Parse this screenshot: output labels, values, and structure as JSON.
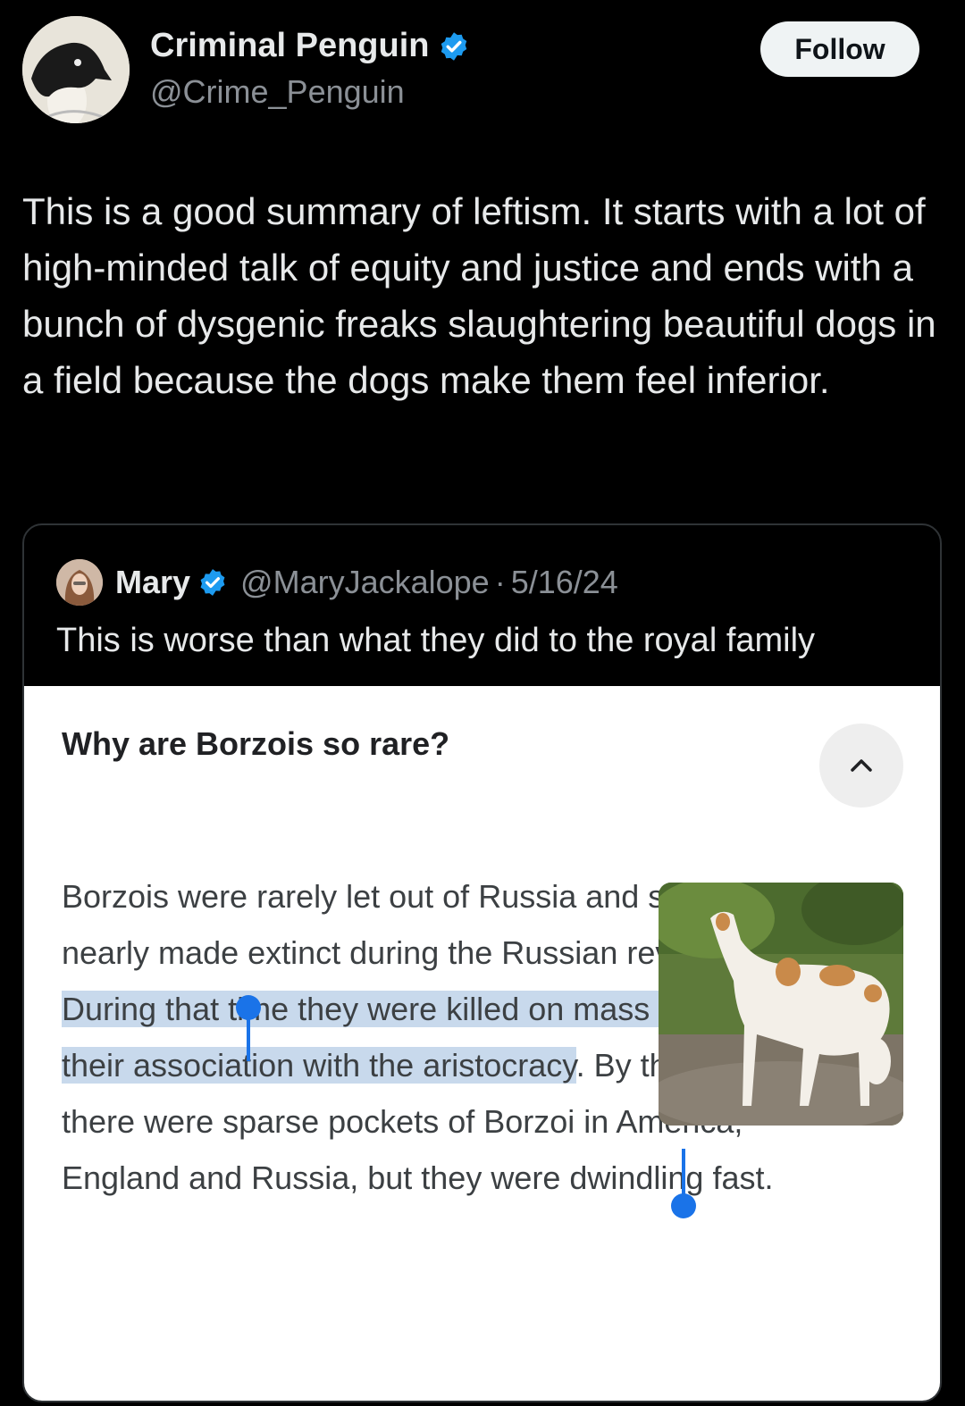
{
  "author": {
    "name": "Criminal Penguin",
    "handle": "@Crime_Penguin",
    "follow_label": "Follow"
  },
  "tweet": {
    "text": "This is a good summary of leftism. It starts with a lot of high-minded talk of equity and justice and ends with a bunch of dysgenic freaks slaughtering beautiful dogs in a field because the dogs make them feel inferior."
  },
  "quoted": {
    "name": "Mary",
    "handle": "@MaryJackalope",
    "separator": "·",
    "date": "5/16/24",
    "text": "This is worse than what they did to the royal family",
    "image": {
      "question": "Why are Borzois so rare?",
      "answer_part1": "Borzois were rarely let out of Russia and so were nearly made extinct during the Russian revolution. ",
      "answer_highlight": "During that time they were killed on mass because of their association with the aristocracy",
      "answer_part2": ". By the 1940s there were sparse pockets of Borzoi in America, England and Russia, but they were dwindling fast."
    }
  },
  "colors": {
    "background": "#000000",
    "verified_blue": "#1d9bf0",
    "selection_blue": "#1a73e8",
    "highlight": "#c8d9ec"
  }
}
